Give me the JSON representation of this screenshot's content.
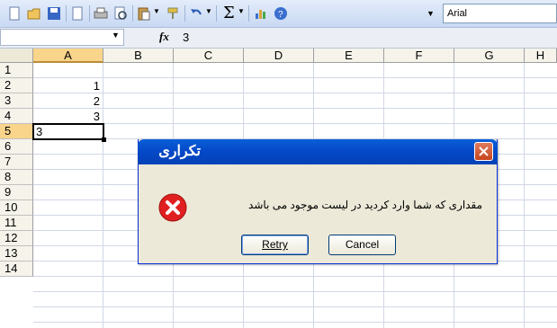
{
  "toolbar": {
    "font_name": "Arial",
    "icons": [
      "new-icon",
      "open-icon",
      "save-icon",
      "permission-icon",
      "print-icon",
      "print-preview-icon",
      "paste-icon",
      "format-painter-icon",
      "undo-icon",
      "autosum-icon",
      "chart-icon",
      "help-icon"
    ]
  },
  "formula_bar": {
    "name_box_value": "",
    "fx_label": "fx",
    "value": "3"
  },
  "sheet": {
    "columns": [
      "A",
      "B",
      "C",
      "D",
      "E",
      "F",
      "G",
      "H"
    ],
    "selected_column": "A",
    "rows": [
      "1",
      "2",
      "3",
      "4",
      "5",
      "6",
      "7",
      "8",
      "9",
      "10",
      "11",
      "12",
      "13",
      "14"
    ],
    "selected_row": "5",
    "cells": {
      "A2": "1",
      "A3": "2",
      "A4": "3",
      "A5": "3"
    }
  },
  "dialog": {
    "title": "تکراری",
    "message": "مقداری که شما وارد کردید در لیست موجود می باشد",
    "retry_label": "Retry",
    "cancel_label": "Cancel"
  },
  "colors": {
    "titlebar": "#0548c7",
    "error_icon": "#e02020",
    "selected_header": "#f9d48b"
  }
}
